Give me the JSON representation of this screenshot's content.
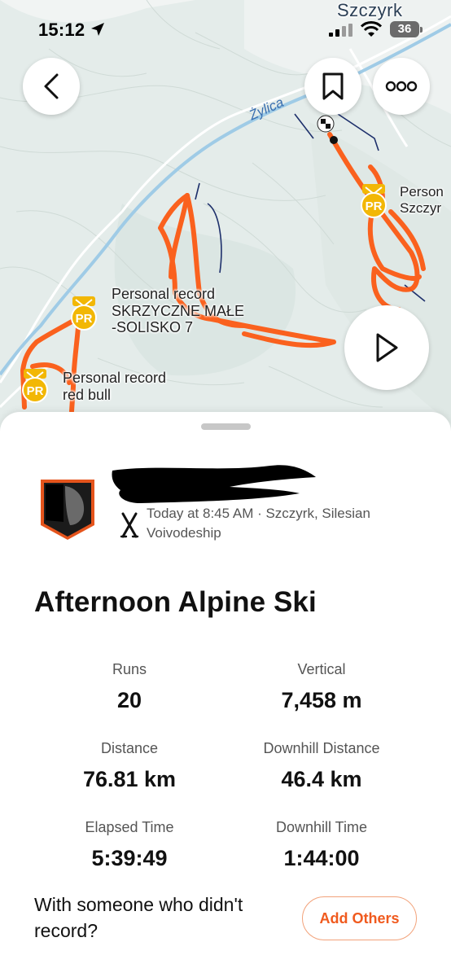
{
  "status_bar": {
    "time": "15:12",
    "battery": "36",
    "icons": [
      "location-arrow-icon",
      "cellular-signal-icon",
      "wifi-icon",
      "battery-icon"
    ]
  },
  "map": {
    "town_label": "Szczyrk",
    "river_label": "Żylica",
    "pr_labels": [
      {
        "line1": "Personal record",
        "line2": "SKRZYCZNE MAŁE",
        "line3": "-SOLISKO 7"
      },
      {
        "line1": "Personal record",
        "line2": "red bull"
      },
      {
        "line1": "Person",
        "line2": "Szczyr"
      }
    ],
    "pr_badge_text": "PR",
    "colors": {
      "track": "#fc5a14",
      "pr_gold": "#f2b705",
      "background": "#e9efee",
      "river": "#8cc4e8"
    },
    "buttons": {
      "back": "chevron-left-icon",
      "save": "bookmark-icon",
      "more": "more-dots-icon",
      "play": "play-icon"
    }
  },
  "sheet": {
    "athlete": {
      "meta": "Today at 8:45 AM · Szczyrk, Silesian Voivodeship",
      "sport_icon": "alpine-ski-icon"
    },
    "title": "Afternoon Alpine Ski",
    "stats": [
      {
        "label": "Runs",
        "value": "20"
      },
      {
        "label": "Vertical",
        "value": "7,458 m"
      },
      {
        "label": "Distance",
        "value": "76.81 km"
      },
      {
        "label": "Downhill Distance",
        "value": "46.4 km"
      },
      {
        "label": "Elapsed Time",
        "value": "5:39:49"
      },
      {
        "label": "Downhill Time",
        "value": "1:44:00"
      }
    ],
    "prompt": "With someone who didn't record?",
    "add_others_label": "Add Others",
    "accent": "#f05a1e"
  }
}
